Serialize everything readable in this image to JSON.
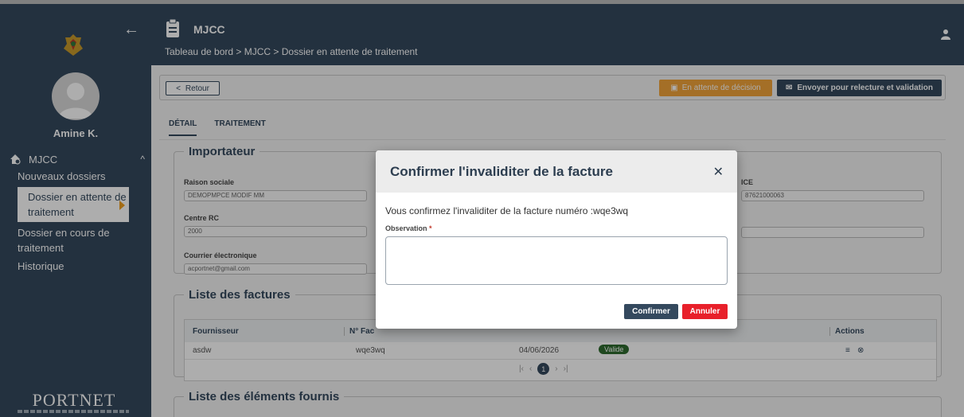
{
  "header": {
    "title": "MJCC",
    "breadcrumb": "Tableau de bord > MJCC > Dossier en attente de traitement"
  },
  "sidebar": {
    "user_name": "Amine K.",
    "root_label": "MJCC",
    "items": [
      {
        "label": "Nouveaux dossiers"
      },
      {
        "label": "Dossier en attente de traitement"
      },
      {
        "label": "Dossier en cours de traitement"
      },
      {
        "label": "Historique"
      }
    ],
    "logo_text": "PORTNET"
  },
  "actions": {
    "back_label": "Retour",
    "status_label": "En attente de décision",
    "send_label": "Envoyer pour relecture et validation"
  },
  "tabs": [
    {
      "label": "DÉTAIL"
    },
    {
      "label": "TRAITEMENT"
    }
  ],
  "importateur": {
    "legend": "Importateur",
    "raison_sociale_label": "Raison sociale",
    "raison_sociale_value": "DEMOPMPCE MODIF MM",
    "centre_rc_label": "Centre RC",
    "centre_rc_value": "2000",
    "courrier_label": "Courrier électronique",
    "courrier_value": "acportnet@gmail.com",
    "ice_label": "ICE",
    "ice_value": "87621000063"
  },
  "factures": {
    "legend": "Liste des factures",
    "columns": [
      "Fournisseur",
      "N° Fac",
      "Actions"
    ],
    "rows": [
      {
        "fournisseur": "asdw",
        "numero": "wqe3wq",
        "date": "04/06/2026",
        "status": "Valide"
      }
    ],
    "page": "1"
  },
  "elements": {
    "legend": "Liste des éléments fournis"
  },
  "modal": {
    "title": "Confirmer l'invaliditer de la facture",
    "message": "Vous confirmez l'invaliditer de la facture numéro :wqe3wq",
    "observation_label": "Observation",
    "observation_value": "",
    "confirm_label": "Confirmer",
    "cancel_label": "Annuler"
  },
  "colors": {
    "primary": "#34495e",
    "warning": "#f2a43a",
    "danger": "#e8202a",
    "success": "#2e6b2e"
  }
}
